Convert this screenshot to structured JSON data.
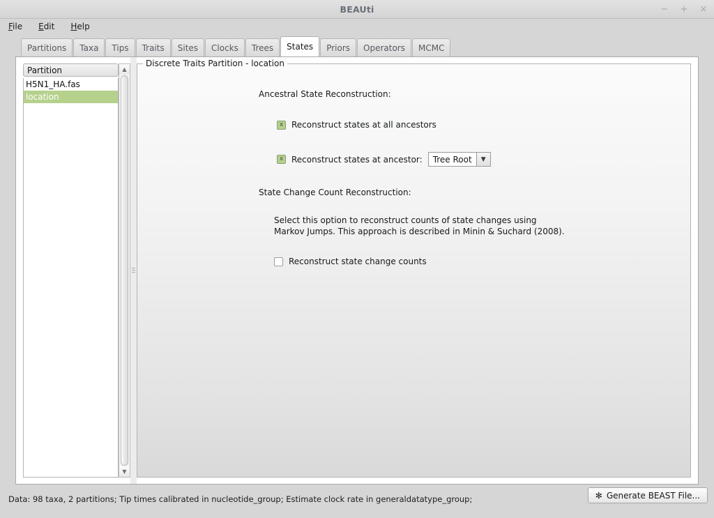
{
  "window": {
    "title": "BEAUti",
    "controls": [
      {
        "name": "minimize",
        "glyph": "−"
      },
      {
        "name": "maximize",
        "glyph": "+"
      },
      {
        "name": "close",
        "glyph": "×"
      }
    ]
  },
  "menubar": {
    "items": [
      {
        "mnemonic": "F",
        "rest": "ile"
      },
      {
        "mnemonic": "E",
        "rest": "dit"
      },
      {
        "mnemonic": "H",
        "rest": "elp"
      }
    ]
  },
  "tabs": {
    "active": "States",
    "items": [
      "Partitions",
      "Taxa",
      "Tips",
      "Traits",
      "Sites",
      "Clocks",
      "Trees",
      "States",
      "Priors",
      "Operators",
      "MCMC"
    ]
  },
  "left_panel": {
    "header": "Partition",
    "rows": [
      {
        "label": "H5N1_HA.fas",
        "selected": false
      },
      {
        "label": "location",
        "selected": true
      }
    ]
  },
  "main": {
    "group_title": "Discrete Traits Partition - location",
    "ancestral": {
      "heading": "Ancestral State Reconstruction:",
      "all_ancestors": {
        "label": "Reconstruct states at all ancestors",
        "checked": true,
        "mark": "x"
      },
      "at_ancestor": {
        "label": "Reconstruct states at ancestor:",
        "checked": true,
        "mark": "x",
        "combo_value": "Tree Root",
        "combo_arrow": "▼"
      }
    },
    "state_change": {
      "heading": "State Change Count Reconstruction:",
      "description_line1": "Select this option to reconstruct counts of state changes using",
      "description_line2": "Markov Jumps. This approach is described in Minin & Suchard (2008).",
      "checkbox": {
        "label": "Reconstruct state change counts",
        "checked": false
      }
    }
  },
  "statusbar": {
    "text": "Data: 98 taxa, 2 partitions; Tip times calibrated in nucleotide_group; Estimate clock rate in generaldatatype_group;",
    "generate_button": {
      "label": "Generate BEAST File...",
      "icon": "gear-icon",
      "glyph": "✻"
    }
  },
  "colors": {
    "selection_green": "#b5d18c",
    "window_chrome": "#d6d6d6",
    "active_tab": "#ffffff"
  }
}
